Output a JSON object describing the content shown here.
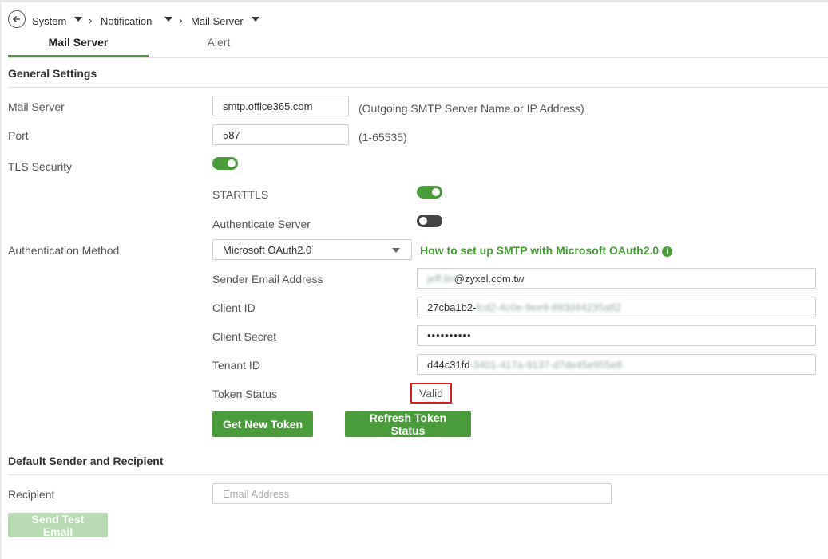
{
  "breadcrumb": {
    "items": [
      "System",
      "Notification",
      "Mail Server"
    ]
  },
  "tabs": [
    {
      "label": "Mail Server",
      "active": true
    },
    {
      "label": "Alert",
      "active": false
    }
  ],
  "general": {
    "title": "General Settings",
    "mail_server": {
      "label": "Mail Server",
      "value": "smtp.office365.com",
      "hint": "(Outgoing SMTP Server Name or IP Address)"
    },
    "port": {
      "label": "Port",
      "value": "587",
      "hint": "(1-65535)"
    },
    "tls": {
      "label": "TLS Security",
      "on": true
    },
    "starttls": {
      "label": "STARTTLS",
      "on": true
    },
    "auth_server": {
      "label": "Authenticate Server",
      "on": false
    },
    "auth_method": {
      "label": "Authentication Method",
      "value": "Microsoft OAuth2.0"
    },
    "oauth_link": "How to set up SMTP with Microsoft OAuth2.0",
    "info_icon": "i",
    "sender": {
      "label": "Sender Email Address",
      "blurred": "jeff.lin",
      "value": "@zyxel.com.tw"
    },
    "client_id": {
      "label": "Client ID",
      "value": "27cba1b2-",
      "blurred": "fcd2-4c0e-9ee9-893d44235a82"
    },
    "client_secret": {
      "label": "Client Secret",
      "value": "••••••••••"
    },
    "tenant_id": {
      "label": "Tenant ID",
      "value": "d44c31fd",
      "blurred": "-3401-417a-9137-d7de45e955e8"
    },
    "token_status": {
      "label": "Token Status",
      "value": "Valid"
    },
    "get_token_label": "Get New Token",
    "refresh_label": "Refresh Token Status"
  },
  "defaults": {
    "title": "Default Sender and Recipient",
    "recipient": {
      "label": "Recipient",
      "placeholder": "Email Address"
    },
    "send_test_label": "Send Test Email"
  },
  "colors": {
    "accent": "#4a9b3a",
    "highlight": "#d32020"
  },
  "icons": {
    "back": "arrow-left-circle-icon",
    "dropdown": "caret-down-icon",
    "separator": "chevron-right-icon",
    "info": "info-icon"
  }
}
